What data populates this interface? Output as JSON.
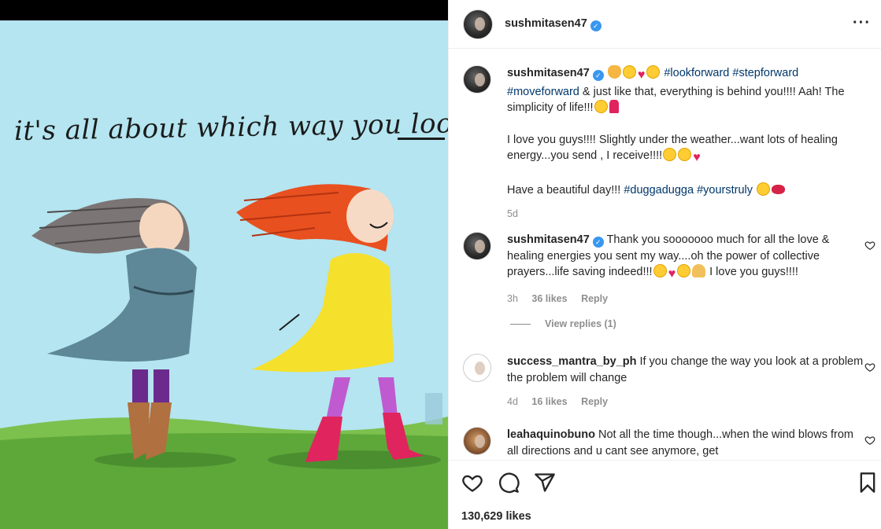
{
  "post": {
    "image_caption": "it's all about which way you look",
    "header_username": "sushmitasen47",
    "likes": "130,629 likes"
  },
  "caption": {
    "username": "sushmitasen47",
    "tags_line1": "#lookforward #stepforward",
    "tag_moveforward": "#moveforward",
    "text1": " & just like that, everything is behind you!!!! Aah! The simplicity of life!!!",
    "text2": "I love you guys!!!! Slightly under the weather...want lots of healing energy...you send , I receive!!!!",
    "text3_pre": "Have a beautiful day!!! ",
    "tag_duggadugga": "#duggadugga",
    "tag_yourstruly": "#yourstruly",
    "time": "5d"
  },
  "comments": [
    {
      "username": "sushmitasen47",
      "text": "Thank you sooooooo much for all the love & healing energies you sent my way....oh the power of collective prayers...life saving indeed!!!",
      "text_tail": " I love you guys!!!!",
      "time": "3h",
      "likes": "36 likes",
      "reply": "Reply",
      "view_replies": "View replies (1)"
    },
    {
      "username": "success_mantra_by_ph",
      "text": "If you change the way you look at a problem the problem will change",
      "time": "4d",
      "likes": "16 likes",
      "reply": "Reply"
    },
    {
      "username": "leahaquinobuno",
      "text": "Not all the time though...when the wind blows from all directions and u cant see anymore, get"
    }
  ],
  "icons": [
    "heart-icon",
    "comment-icon",
    "share-icon",
    "bookmark-icon",
    "more-icon",
    "verified-icon"
  ],
  "colors": {
    "link": "#00376b",
    "verified": "#3897f0",
    "muted": "#8e8e8e",
    "sky": "#b4e5f0"
  }
}
